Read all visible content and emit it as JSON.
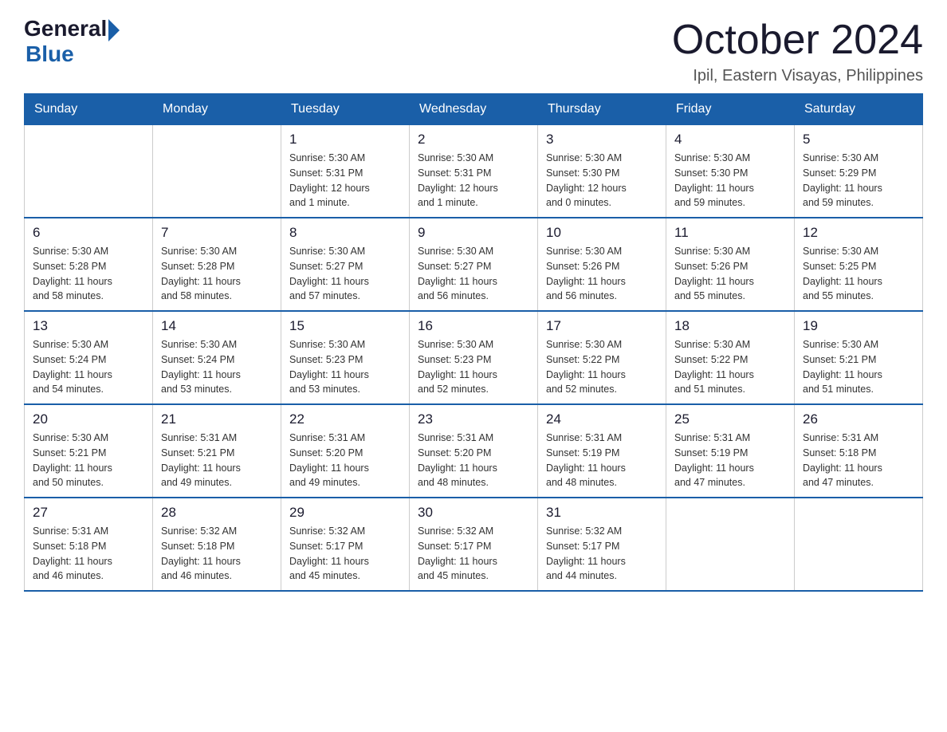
{
  "header": {
    "logo_general": "General",
    "logo_blue": "Blue",
    "month_title": "October 2024",
    "location": "Ipil, Eastern Visayas, Philippines"
  },
  "weekdays": [
    "Sunday",
    "Monday",
    "Tuesday",
    "Wednesday",
    "Thursday",
    "Friday",
    "Saturday"
  ],
  "weeks": [
    [
      {
        "day": "",
        "info": ""
      },
      {
        "day": "",
        "info": ""
      },
      {
        "day": "1",
        "info": "Sunrise: 5:30 AM\nSunset: 5:31 PM\nDaylight: 12 hours\nand 1 minute."
      },
      {
        "day": "2",
        "info": "Sunrise: 5:30 AM\nSunset: 5:31 PM\nDaylight: 12 hours\nand 1 minute."
      },
      {
        "day": "3",
        "info": "Sunrise: 5:30 AM\nSunset: 5:30 PM\nDaylight: 12 hours\nand 0 minutes."
      },
      {
        "day": "4",
        "info": "Sunrise: 5:30 AM\nSunset: 5:30 PM\nDaylight: 11 hours\nand 59 minutes."
      },
      {
        "day": "5",
        "info": "Sunrise: 5:30 AM\nSunset: 5:29 PM\nDaylight: 11 hours\nand 59 minutes."
      }
    ],
    [
      {
        "day": "6",
        "info": "Sunrise: 5:30 AM\nSunset: 5:28 PM\nDaylight: 11 hours\nand 58 minutes."
      },
      {
        "day": "7",
        "info": "Sunrise: 5:30 AM\nSunset: 5:28 PM\nDaylight: 11 hours\nand 58 minutes."
      },
      {
        "day": "8",
        "info": "Sunrise: 5:30 AM\nSunset: 5:27 PM\nDaylight: 11 hours\nand 57 minutes."
      },
      {
        "day": "9",
        "info": "Sunrise: 5:30 AM\nSunset: 5:27 PM\nDaylight: 11 hours\nand 56 minutes."
      },
      {
        "day": "10",
        "info": "Sunrise: 5:30 AM\nSunset: 5:26 PM\nDaylight: 11 hours\nand 56 minutes."
      },
      {
        "day": "11",
        "info": "Sunrise: 5:30 AM\nSunset: 5:26 PM\nDaylight: 11 hours\nand 55 minutes."
      },
      {
        "day": "12",
        "info": "Sunrise: 5:30 AM\nSunset: 5:25 PM\nDaylight: 11 hours\nand 55 minutes."
      }
    ],
    [
      {
        "day": "13",
        "info": "Sunrise: 5:30 AM\nSunset: 5:24 PM\nDaylight: 11 hours\nand 54 minutes."
      },
      {
        "day": "14",
        "info": "Sunrise: 5:30 AM\nSunset: 5:24 PM\nDaylight: 11 hours\nand 53 minutes."
      },
      {
        "day": "15",
        "info": "Sunrise: 5:30 AM\nSunset: 5:23 PM\nDaylight: 11 hours\nand 53 minutes."
      },
      {
        "day": "16",
        "info": "Sunrise: 5:30 AM\nSunset: 5:23 PM\nDaylight: 11 hours\nand 52 minutes."
      },
      {
        "day": "17",
        "info": "Sunrise: 5:30 AM\nSunset: 5:22 PM\nDaylight: 11 hours\nand 52 minutes."
      },
      {
        "day": "18",
        "info": "Sunrise: 5:30 AM\nSunset: 5:22 PM\nDaylight: 11 hours\nand 51 minutes."
      },
      {
        "day": "19",
        "info": "Sunrise: 5:30 AM\nSunset: 5:21 PM\nDaylight: 11 hours\nand 51 minutes."
      }
    ],
    [
      {
        "day": "20",
        "info": "Sunrise: 5:30 AM\nSunset: 5:21 PM\nDaylight: 11 hours\nand 50 minutes."
      },
      {
        "day": "21",
        "info": "Sunrise: 5:31 AM\nSunset: 5:21 PM\nDaylight: 11 hours\nand 49 minutes."
      },
      {
        "day": "22",
        "info": "Sunrise: 5:31 AM\nSunset: 5:20 PM\nDaylight: 11 hours\nand 49 minutes."
      },
      {
        "day": "23",
        "info": "Sunrise: 5:31 AM\nSunset: 5:20 PM\nDaylight: 11 hours\nand 48 minutes."
      },
      {
        "day": "24",
        "info": "Sunrise: 5:31 AM\nSunset: 5:19 PM\nDaylight: 11 hours\nand 48 minutes."
      },
      {
        "day": "25",
        "info": "Sunrise: 5:31 AM\nSunset: 5:19 PM\nDaylight: 11 hours\nand 47 minutes."
      },
      {
        "day": "26",
        "info": "Sunrise: 5:31 AM\nSunset: 5:18 PM\nDaylight: 11 hours\nand 47 minutes."
      }
    ],
    [
      {
        "day": "27",
        "info": "Sunrise: 5:31 AM\nSunset: 5:18 PM\nDaylight: 11 hours\nand 46 minutes."
      },
      {
        "day": "28",
        "info": "Sunrise: 5:32 AM\nSunset: 5:18 PM\nDaylight: 11 hours\nand 46 minutes."
      },
      {
        "day": "29",
        "info": "Sunrise: 5:32 AM\nSunset: 5:17 PM\nDaylight: 11 hours\nand 45 minutes."
      },
      {
        "day": "30",
        "info": "Sunrise: 5:32 AM\nSunset: 5:17 PM\nDaylight: 11 hours\nand 45 minutes."
      },
      {
        "day": "31",
        "info": "Sunrise: 5:32 AM\nSunset: 5:17 PM\nDaylight: 11 hours\nand 44 minutes."
      },
      {
        "day": "",
        "info": ""
      },
      {
        "day": "",
        "info": ""
      }
    ]
  ]
}
